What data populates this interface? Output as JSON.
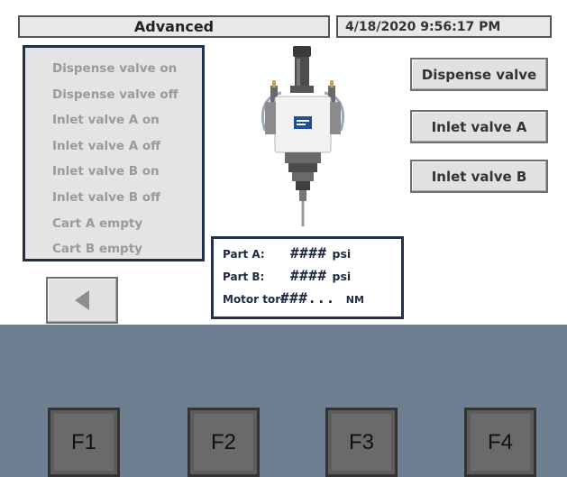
{
  "header": {
    "title": "Advanced",
    "datetime": "4/18/2020 9:56:17 PM"
  },
  "status_list": [
    "Dispense valve on",
    "Dispense valve off",
    "Inlet valve A on",
    "Inlet valve A off",
    "Inlet valve B on",
    "Inlet valve B off",
    "Cart A empty",
    "Cart B empty"
  ],
  "buttons": {
    "dispense_valve": "Dispense valve",
    "inlet_valve_a": "Inlet valve A",
    "inlet_valve_b": "Inlet valve B"
  },
  "readout": {
    "part_a": {
      "label": "Part A:",
      "value": "####",
      "unit": "psi"
    },
    "part_b": {
      "label": "Part B:",
      "value": "####",
      "unit": "psi"
    },
    "motor": {
      "label": "Motor tor:",
      "value": "###...",
      "unit": "NM"
    }
  },
  "function_keys": [
    "F1",
    "F2",
    "F3",
    "F4"
  ],
  "icons": {
    "back": "left-triangle-icon",
    "machine": "dispense-valve-machine-icon"
  }
}
